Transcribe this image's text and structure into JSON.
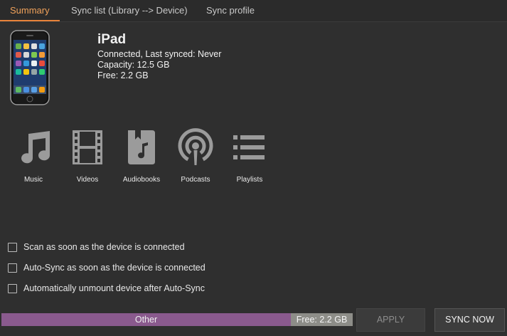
{
  "tabs": [
    {
      "label": "Summary",
      "active": true
    },
    {
      "label": "Sync list (Library --> Device)",
      "active": false
    },
    {
      "label": "Sync profile",
      "active": false
    }
  ],
  "device": {
    "name": "iPad",
    "status": "Connected, Last synced: Never",
    "capacity": "Capacity: 12.5 GB",
    "free": "Free: 2.2 GB",
    "image_icon": "iphone-device-icon"
  },
  "media": [
    {
      "label": "Music",
      "icon": "music-note-icon"
    },
    {
      "label": "Videos",
      "icon": "film-strip-icon"
    },
    {
      "label": "Audiobooks",
      "icon": "audiobook-icon"
    },
    {
      "label": "Podcasts",
      "icon": "podcast-icon"
    },
    {
      "label": "Playlists",
      "icon": "playlist-icon"
    }
  ],
  "options": [
    {
      "label": "Scan as soon as the device is connected",
      "checked": false
    },
    {
      "label": "Auto-Sync as soon as the device is connected",
      "checked": false
    },
    {
      "label": "Automatically unmount device after Auto-Sync",
      "checked": false
    }
  ],
  "usage": {
    "other_label": "Other",
    "free_label": "Free: 2.2 GB",
    "other_fraction": 0.824,
    "free_fraction": 0.176,
    "other_color": "#8a5a8e",
    "free_color": "#8d8d88"
  },
  "buttons": {
    "apply": "APPLY",
    "sync_now": "SYNC NOW"
  },
  "colors": {
    "accent": "#e8833a",
    "background": "#2f2f2f",
    "icon": "#9b9b9b"
  }
}
